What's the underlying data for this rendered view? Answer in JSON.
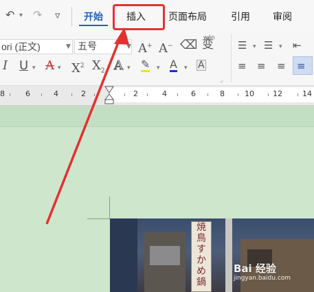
{
  "quick_access": {
    "more_symbol": "▿"
  },
  "tabs": [
    {
      "label": "开始",
      "active": true
    },
    {
      "label": "插入",
      "active": false,
      "highlighted": true
    },
    {
      "label": "页面布局",
      "active": false
    },
    {
      "label": "引用",
      "active": false
    },
    {
      "label": "审阅",
      "active": false
    }
  ],
  "ribbon": {
    "font_name": "ori (正文)",
    "font_size": "五号",
    "phonetic_guide": "wén"
  },
  "ruler": {
    "labels": [
      "8",
      "6",
      "4",
      "2",
      "2",
      "2",
      "4",
      "6",
      "8",
      "10",
      "12",
      "14"
    ]
  },
  "document": {
    "sign_text": [
      "焼",
      "鳥",
      "す",
      "か",
      "め",
      "鍋"
    ],
    "watermark": "Bai 经验",
    "watermark_url": "jingyan.baidu.com"
  },
  "colors": {
    "accent_blue": "#1f5fbf",
    "highlight_red": "#e53030",
    "doc_bg_green": "#cde6cc"
  }
}
